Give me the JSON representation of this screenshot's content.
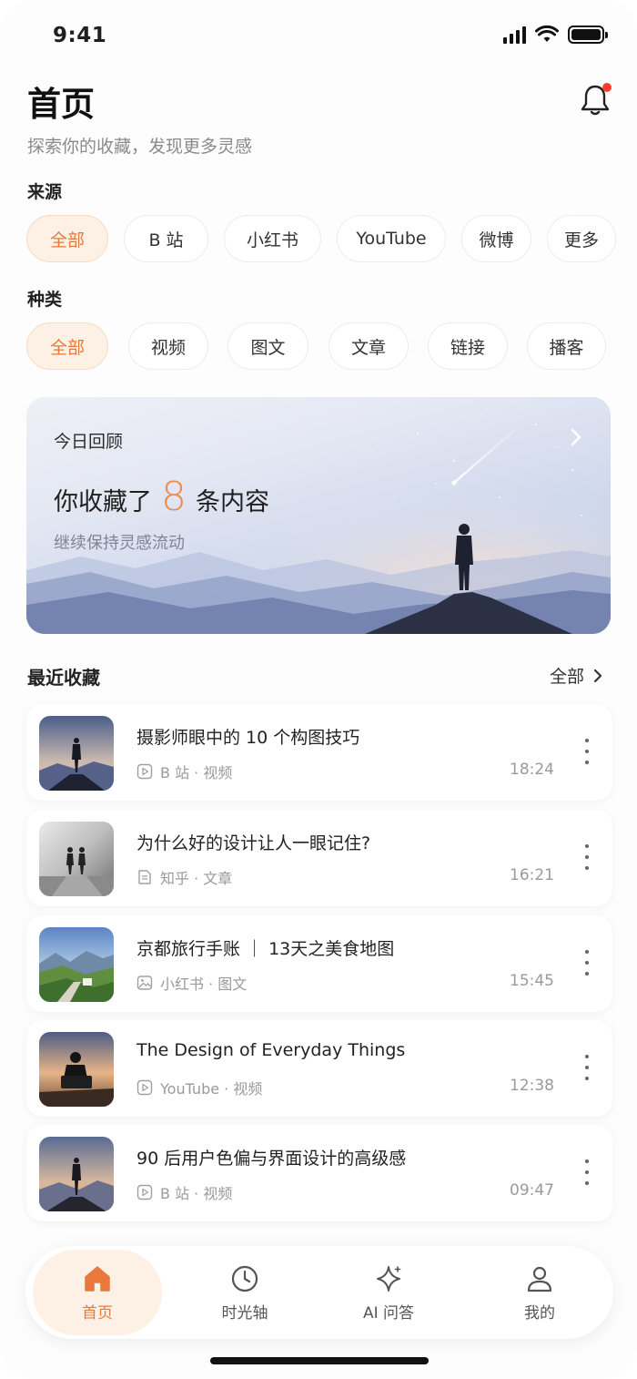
{
  "status_bar": {
    "time": "9:41"
  },
  "header": {
    "title": "首页",
    "subtitle": "探索你的收藏，发现更多灵感",
    "bell_icon": "bell-icon",
    "notification_dot_color": "#ff3b30"
  },
  "source_filter": {
    "label": "来源",
    "chips": [
      "全部",
      "B 站",
      "小红书",
      "YouTube",
      "微博",
      "更多"
    ],
    "selected": "全部"
  },
  "type_filter": {
    "label": "种类",
    "chips": [
      "全部",
      "视频",
      "图文",
      "文章",
      "链接",
      "播客"
    ],
    "selected": "全部"
  },
  "banner": {
    "label": "今日回顾",
    "headline_prefix": "你收藏了",
    "count": "8",
    "headline_suffix": "条内容",
    "subtitle": "继续保持灵感流动"
  },
  "recent": {
    "title": "最近收藏",
    "view_all": "全部",
    "items": [
      {
        "title": "摄影师眼中的 10 个构图技巧",
        "meta": "B 站 · 视频",
        "time": "18:24",
        "type_icon": "play-icon"
      },
      {
        "title": "为什么好的设计让人一眼记住?",
        "meta": "知乎 · 文章",
        "time": "16:21",
        "type_icon": "document-icon"
      },
      {
        "title": "京都旅行手账 ｜ 13天之美食地图",
        "meta": "小红书 · 图文",
        "time": "15:45",
        "type_icon": "image-icon"
      },
      {
        "title": "The Design of Everyday Things",
        "meta": "YouTube · 视频",
        "time": "12:38",
        "type_icon": "play-icon"
      },
      {
        "title": "90 后用户色偏与界面设计的高级感",
        "meta": "B 站 · 视频",
        "time": "09:47",
        "type_icon": "play-icon"
      }
    ]
  },
  "tabbar": {
    "tabs": [
      {
        "label": "首页",
        "icon": "home-icon",
        "active": true
      },
      {
        "label": "时光轴",
        "icon": "clock-icon",
        "active": false
      },
      {
        "label": "AI 问答",
        "icon": "sparkle-icon",
        "active": false
      },
      {
        "label": "我的",
        "icon": "user-icon",
        "active": false
      }
    ]
  },
  "colors": {
    "accent": "#e8793a",
    "accent_bg": "#fdf1e6",
    "count_color": "#ef8a48"
  }
}
